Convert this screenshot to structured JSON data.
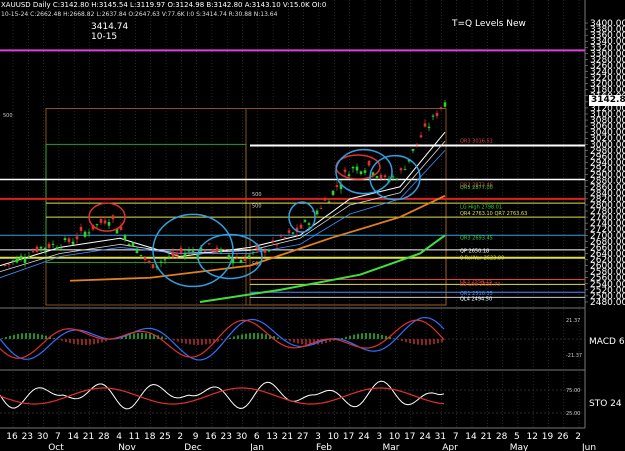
{
  "header": {
    "symbol_line": "XAUUSD  Daily  C:3142.80  H:3145.54  L:3119.97  O:3124.98  B:3142.80  A:3143.10  V:15.0K  OI:0",
    "stats_line": "10-15-24  C:2662.48  H:2668.82  L:2637.84  O:2647.63  V:77.6K  I:0  S:3414.74  R:30.88  N:13.64",
    "big_value": "3414.74",
    "big_date": "10-15"
  },
  "title": "T=Q Levels New",
  "current_price": "3142.80",
  "price_axis": {
    "ticks": [
      "3400.00",
      "3380.00",
      "3360.00",
      "3340.00",
      "3320.00",
      "3300.00",
      "3280.00",
      "3260.00",
      "3240.00",
      "3220.00",
      "3200.00",
      "3180.00",
      "3160.00",
      "3140.00",
      "3120.00",
      "3100.00",
      "3080.00",
      "3060.00",
      "3040.00",
      "3020.00",
      "3000.00",
      "2980.00",
      "2960.00",
      "2940.00",
      "2920.00",
      "2900.00",
      "2880.00",
      "2860.00",
      "2840.00",
      "2820.00",
      "2800.00",
      "2780.00",
      "2760.00",
      "2740.00",
      "2720.00",
      "2700.00",
      "2680.00",
      "2660.00",
      "2640.00",
      "2620.00",
      "2600.00",
      "2580.00",
      "2560.00",
      "2540.00",
      "2520.00",
      "2500.00",
      "2480.00"
    ],
    "min": 2470,
    "max": 3410
  },
  "level_labels": [
    {
      "text": "QR3 3016.51",
      "price": 3016,
      "color": "#e04040"
    },
    {
      "text": "QR2 2873.46",
      "price": 2870,
      "color": "#e04040"
    },
    {
      "text": "QR5 2877.00",
      "price": 2862,
      "color": "#30d030"
    },
    {
      "text": "LG High 2798.01",
      "price": 2798,
      "color": "#30d030"
    },
    {
      "text": "QR4 2763.10 QR7 2763.63",
      "price": 2776,
      "color": "#e0e040"
    },
    {
      "text": "QR3 2693.45",
      "price": 2696,
      "color": "#30d030"
    },
    {
      "text": "QP 2650.18",
      "price": 2653,
      "color": "#ffffff"
    },
    {
      "text": "0 RollVar 2623.80",
      "price": 2630,
      "color": "#e0e040"
    },
    {
      "text": "QL3 2554.15",
      "price": 2553,
      "color": "#e04040"
    },
    {
      "text": "LG Low 2535.73",
      "price": 2542,
      "color": "#e04040"
    },
    {
      "text": "QR1 2510.35",
      "price": 2513,
      "color": "#4090ff"
    },
    {
      "text": "QL4 2494.50",
      "price": 2495,
      "color": "#ffffff"
    }
  ],
  "box_labels": [
    "500",
    "500",
    "500",
    "500"
  ],
  "indicators": {
    "macd_label": "MACD 6",
    "macd_ticks": [
      "21.37",
      "-21.37"
    ],
    "sto_label": "STO 24",
    "sto_ticks": [
      "75.00",
      "25.00"
    ]
  },
  "date_axis": {
    "days": [
      "16",
      "23",
      "30",
      "7",
      "14",
      "21",
      "28",
      "4",
      "11",
      "18",
      "25",
      "2",
      "9",
      "16",
      "23",
      "30",
      "6",
      "13",
      "21",
      "27",
      "3",
      "10",
      "17",
      "24",
      "3",
      "10",
      "17",
      "24",
      "31",
      "7",
      "14",
      "21",
      "28",
      "5",
      "12",
      "19",
      "26",
      "2"
    ],
    "months": [
      "Oct",
      "Nov",
      "Dec",
      "Jan",
      "Feb",
      "Mar",
      "Apr",
      "May",
      "Jun"
    ]
  },
  "colors": {
    "up_candle": "#30d030",
    "down_candle": "#e03030",
    "magenta": "#e040e0",
    "orange": "#e08020",
    "green_ma": "#40e040",
    "blue_circle": "#30a0e0",
    "red_circle": "#e03030"
  }
}
